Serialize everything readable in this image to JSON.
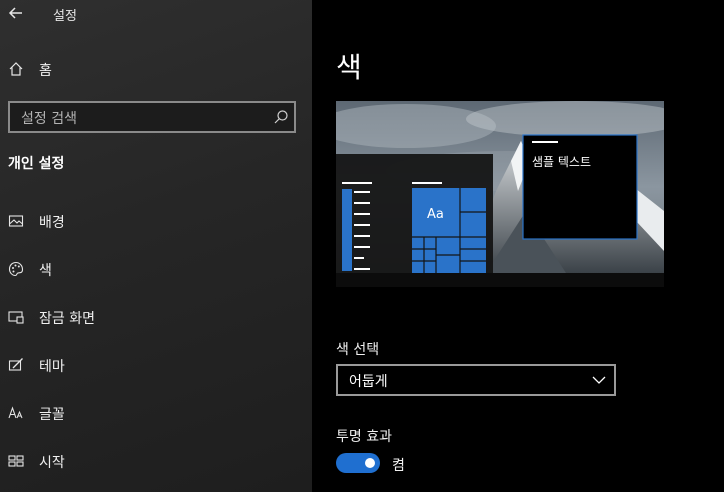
{
  "window": {
    "title": "설정"
  },
  "sidebar": {
    "home_label": "홈",
    "search_placeholder": "설정 검색",
    "section_title": "개인 설정",
    "items": [
      {
        "label": "배경",
        "icon": "picture-icon"
      },
      {
        "label": "색",
        "icon": "palette-icon"
      },
      {
        "label": "잠금 화면",
        "icon": "lock-screen-icon"
      },
      {
        "label": "테마",
        "icon": "theme-icon"
      },
      {
        "label": "글꼴",
        "icon": "font-icon"
      },
      {
        "label": "시작",
        "icon": "start-icon"
      }
    ]
  },
  "main": {
    "title": "색",
    "preview": {
      "tile_text": "Aa",
      "sample_text": "샘플 텍스트"
    },
    "color_select": {
      "label": "색 선택",
      "value": "어둡게"
    },
    "transparency": {
      "label": "투명 효과",
      "state": "켬",
      "on": true
    }
  },
  "colors": {
    "accent": "#2a73c9",
    "sidebar_bg": "#262626",
    "main_bg": "#000000"
  }
}
